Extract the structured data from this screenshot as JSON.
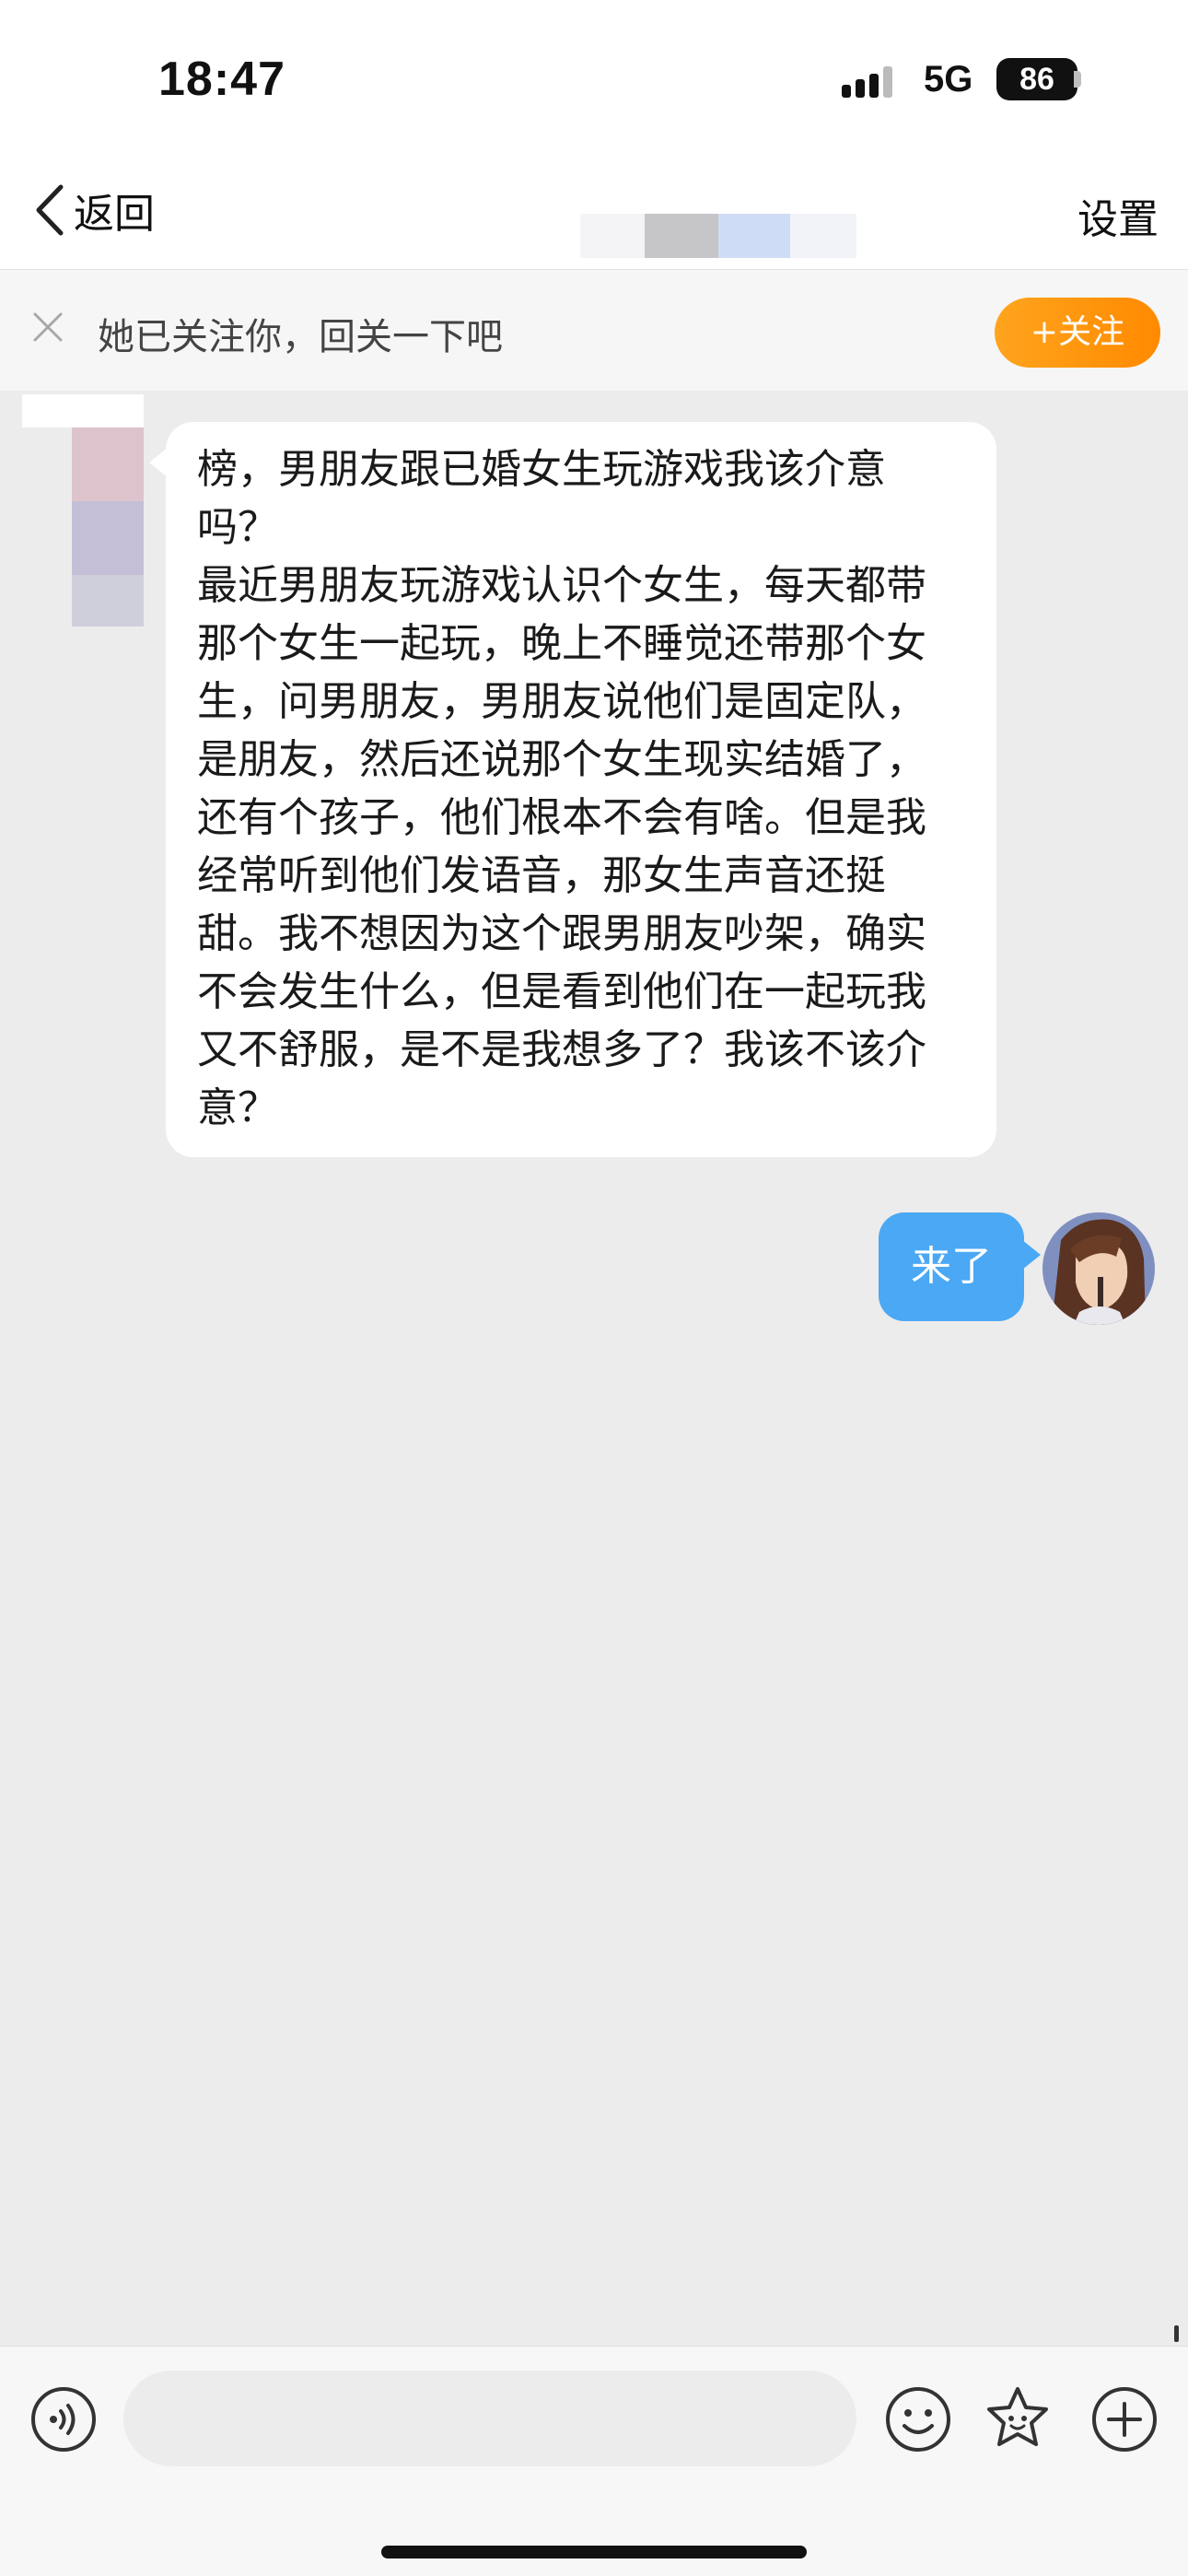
{
  "status_bar": {
    "time": "18:47",
    "network": "5G",
    "battery": "86"
  },
  "nav": {
    "back_label": "返回",
    "settings_label": "设置"
  },
  "follow_bar": {
    "text": "她已关注你，回关一下吧",
    "button_label": "+关注"
  },
  "messages": [
    {
      "side": "left",
      "text": "榜，男朋友跟已婚女生玩游戏我该介意吗？\n最近男朋友玩游戏认识个女生，每天都带那个女生一起玩，晚上不睡觉还带那个女生，问男朋友，男朋友说他们是固定队，是朋友，然后还说那个女生现实结婚了，还有个孩子，他们根本不会有啥。但是我经常听到他们发语音，那女生声音还挺甜。我不想因为这个跟男朋友吵架，确实不会发生什么，但是看到他们在一起玩我又不舒服，是不是我想多了？我该不该介意？"
    },
    {
      "side": "right",
      "text": "来了"
    }
  ],
  "input_bar": {
    "placeholder": "",
    "icons": [
      "voice-icon",
      "emoji-icon",
      "sticker-icon",
      "plus-icon"
    ]
  },
  "colors": {
    "accent_orange": "#ff9a12",
    "bubble_blue": "#4aa8f4",
    "chat_background": "#ececec"
  }
}
